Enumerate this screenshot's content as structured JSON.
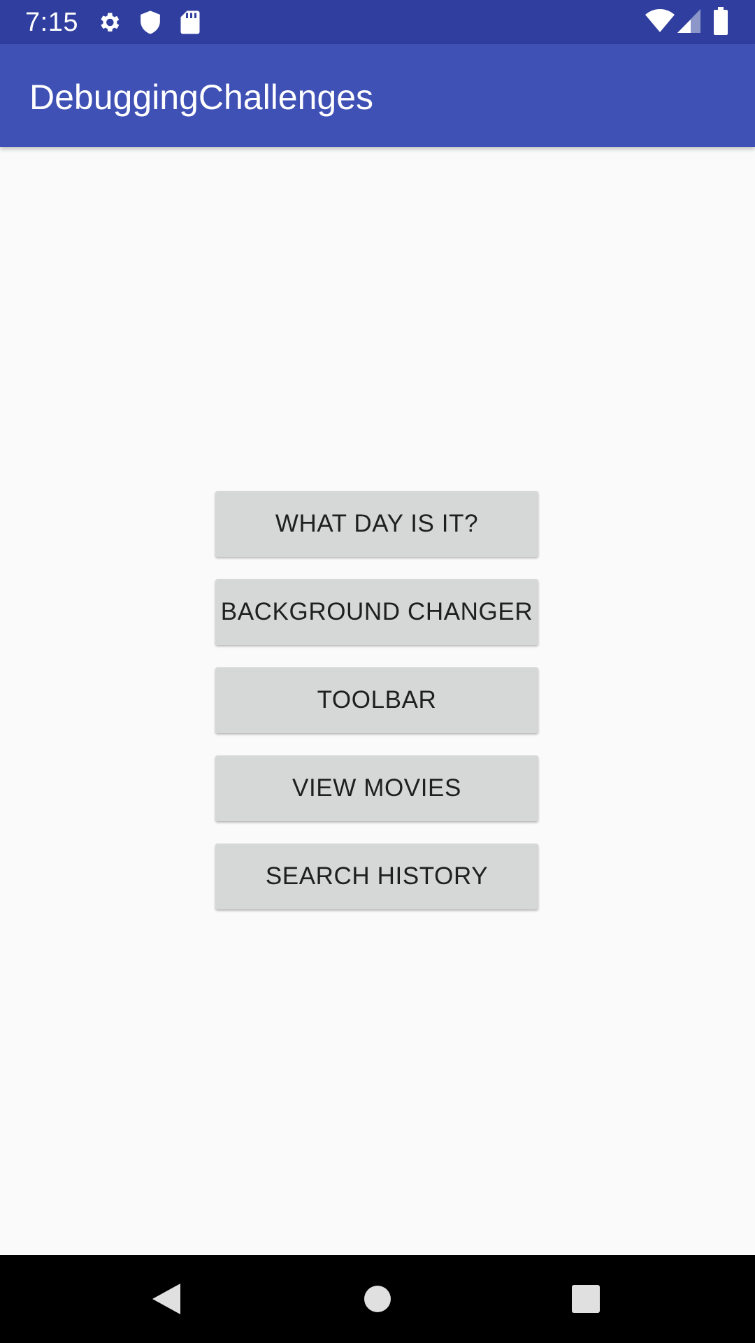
{
  "status_bar": {
    "time": "7:15",
    "left_icons": [
      "gear-icon",
      "shield-icon",
      "sd-card-icon"
    ],
    "right_icons": [
      "wifi-icon",
      "cell-signal-icon",
      "battery-icon"
    ],
    "color": "#303f9f"
  },
  "app_bar": {
    "title": "DebuggingChallenges",
    "color": "#3f51b5"
  },
  "main": {
    "buttons": [
      {
        "label": "WHAT DAY IS IT?"
      },
      {
        "label": "BACKGROUND CHANGER"
      },
      {
        "label": "TOOLBAR"
      },
      {
        "label": "VIEW MOVIES"
      },
      {
        "label": "SEARCH HISTORY"
      }
    ],
    "button_color": "#d6d7d7"
  },
  "nav_bar": {
    "buttons": [
      "back-icon",
      "home-icon",
      "recents-icon"
    ]
  }
}
